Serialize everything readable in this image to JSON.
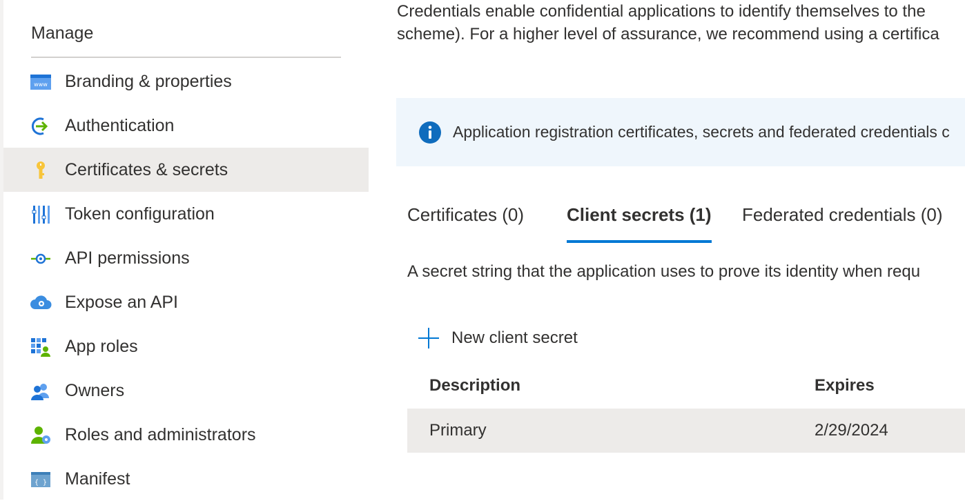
{
  "sidebar": {
    "section_title": "Manage",
    "items": [
      {
        "label": "Branding & properties",
        "icon": "branding-icon"
      },
      {
        "label": "Authentication",
        "icon": "authentication-icon"
      },
      {
        "label": "Certificates & secrets",
        "icon": "key-icon",
        "active": true
      },
      {
        "label": "Token configuration",
        "icon": "token-configuration-icon"
      },
      {
        "label": "API permissions",
        "icon": "api-permissions-icon"
      },
      {
        "label": "Expose an API",
        "icon": "cloud-gear-icon"
      },
      {
        "label": "App roles",
        "icon": "app-roles-icon"
      },
      {
        "label": "Owners",
        "icon": "owners-icon"
      },
      {
        "label": "Roles and administrators",
        "icon": "roles-admin-icon"
      },
      {
        "label": "Manifest",
        "icon": "manifest-icon"
      }
    ]
  },
  "main": {
    "intro_line1": "Credentials enable confidential applications to identify themselves to the",
    "intro_line2": "scheme). For a higher level of assurance, we recommend using a certifica",
    "info_text": "Application registration certificates, secrets and federated credentials c",
    "tabs": [
      {
        "label": "Certificates (0)"
      },
      {
        "label": "Client secrets (1)",
        "active": true
      },
      {
        "label": "Federated credentials (0)"
      }
    ],
    "tab_description": "A secret string that the application uses to prove its identity when requ",
    "new_secret_label": "New client secret",
    "table": {
      "headers": [
        "Description",
        "Expires"
      ],
      "rows": [
        {
          "description": "Primary",
          "expires": "2/29/2024"
        }
      ]
    }
  },
  "colors": {
    "accent": "#0078d4",
    "active_bg": "#edebe9",
    "info_bg": "#eff6fc",
    "info_icon": "#0f6cbd"
  }
}
